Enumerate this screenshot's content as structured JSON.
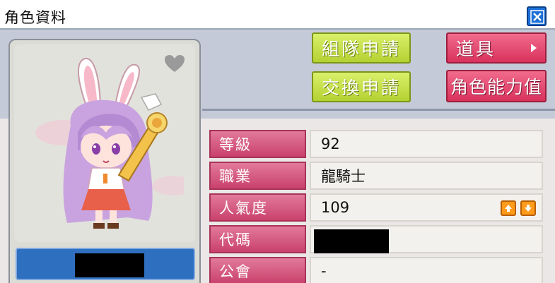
{
  "window": {
    "title": "角色資料"
  },
  "buttons": {
    "party_request": "組隊申請",
    "trade_request": "交換申請",
    "items": "道具",
    "ability": "角色能力值"
  },
  "character": {
    "name": ""
  },
  "info_rows": [
    {
      "label": "等級",
      "value": "92"
    },
    {
      "label": "職業",
      "value": "龍騎士"
    },
    {
      "label": "人氣度",
      "value": "109"
    },
    {
      "label": "代碼",
      "value": ""
    },
    {
      "label": "公會",
      "value": "-"
    }
  ],
  "colors": {
    "accent_pink": "#d9325c",
    "accent_green": "#b4d132",
    "name_bar": "#2f6fc0",
    "fame_button": "#ff9a1a"
  },
  "icons": {
    "close": "close-icon",
    "favorite": "heart-icon",
    "fame_up": "arrow-up-icon",
    "fame_down": "arrow-down-icon",
    "submenu": "chevron-right-icon"
  }
}
